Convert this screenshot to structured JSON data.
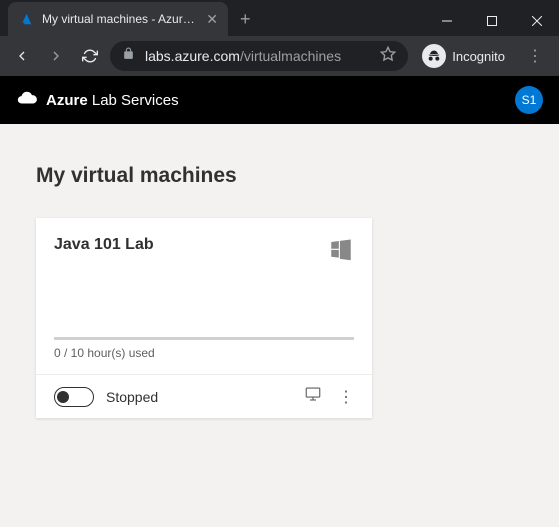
{
  "browser": {
    "tab_title": "My virtual machines - Azure Lab",
    "url_host": "labs.azure.com",
    "url_path": "/virtualmachines",
    "incognito_label": "Incognito"
  },
  "header": {
    "brand_bold": "Azure",
    "brand_rest": " Lab Services",
    "avatar": "S1"
  },
  "page": {
    "title": "My virtual machines"
  },
  "vm": {
    "name": "Java 101 Lab",
    "os": "windows",
    "usage_text": "0 / 10 hour(s) used",
    "status": "Stopped"
  },
  "colors": {
    "accent": "#0078d4"
  }
}
